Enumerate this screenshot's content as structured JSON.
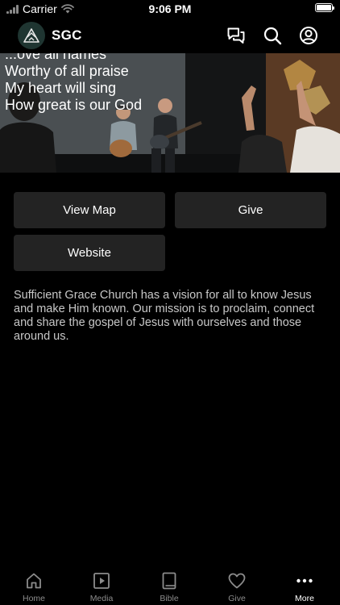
{
  "status_bar": {
    "carrier": "Carrier",
    "time": "9:06 PM"
  },
  "header": {
    "title": "SGC",
    "icons": [
      "logo-icon",
      "chat-icon",
      "search-icon",
      "profile-icon"
    ]
  },
  "hero": {
    "lyrics": [
      "...ove all names",
      "Worthy of all praise",
      "My heart will sing",
      "How great is our God"
    ]
  },
  "actions": {
    "view_map": "View Map",
    "give": "Give",
    "website": "Website"
  },
  "description": "Sufficient Grace Church has a vision for all to know Jesus and make Him known. Our mission is to proclaim, connect and share the gospel of Jesus with ourselves and those around us.",
  "tabbar": {
    "items": [
      {
        "label": "Home",
        "icon": "home-icon"
      },
      {
        "label": "Media",
        "icon": "play-icon"
      },
      {
        "label": "Bible",
        "icon": "book-icon"
      },
      {
        "label": "Give",
        "icon": "heart-icon"
      },
      {
        "label": "More",
        "icon": "more-icon"
      }
    ],
    "active": "More"
  },
  "colors": {
    "background": "#000000",
    "button": "#232323",
    "logo_bg": "#1f3531",
    "inactive": "#8c8c8c"
  }
}
